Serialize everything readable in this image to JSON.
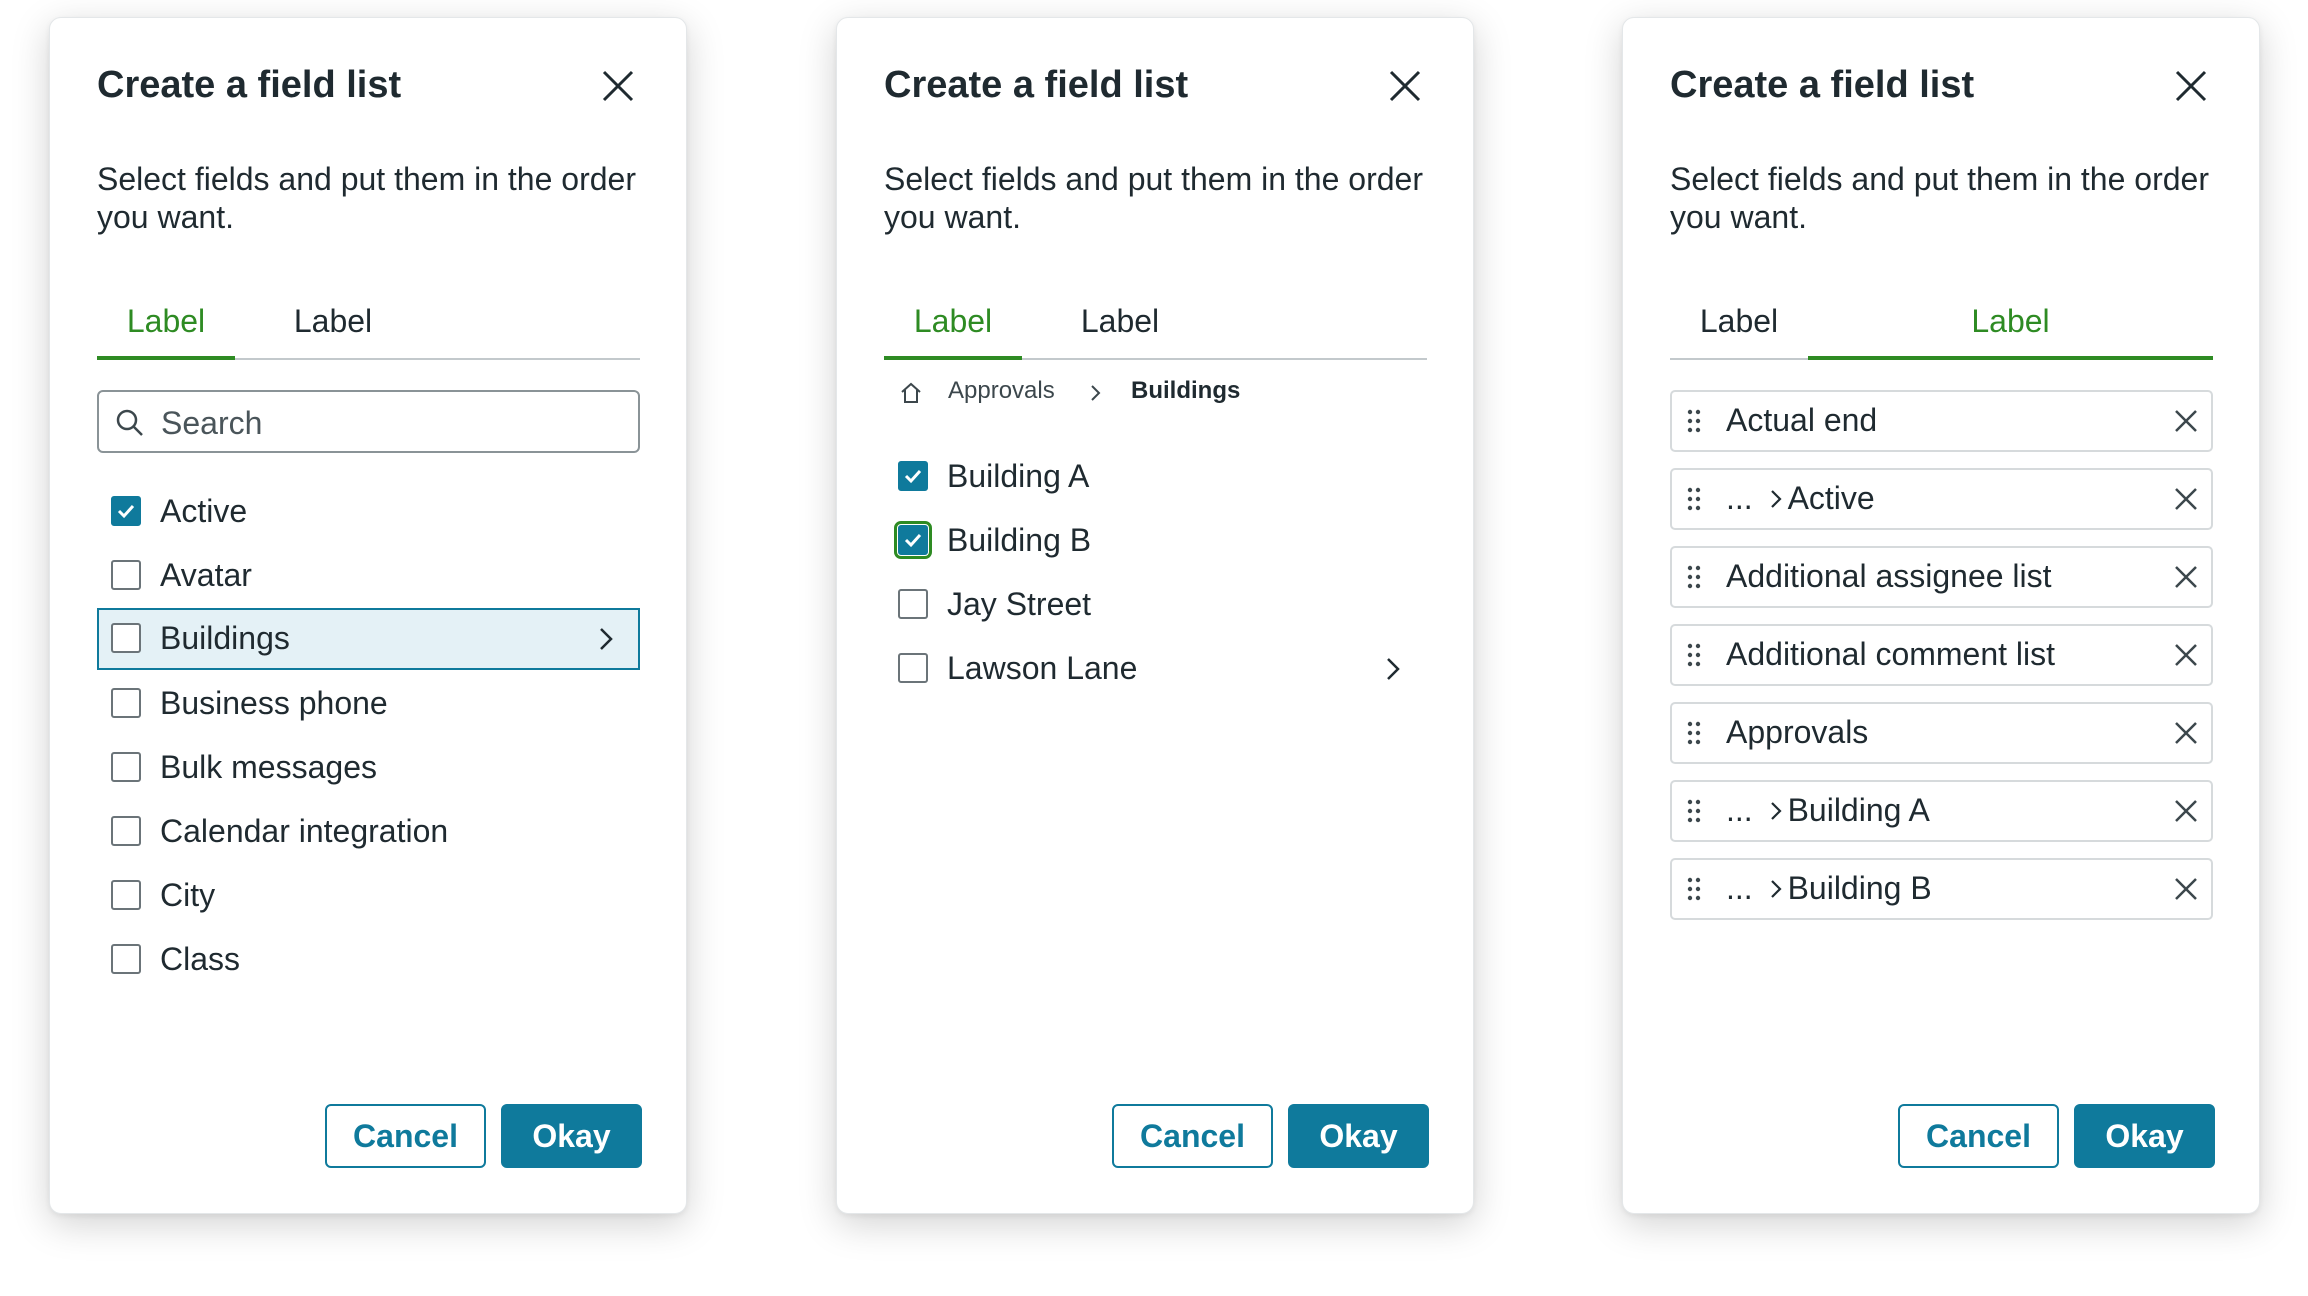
{
  "colors": {
    "accent": "#0f7a9c",
    "tab_active": "#2e8b23",
    "highlight_bg": "#e4f1f6"
  },
  "dialogs": [
    {
      "title": "Create a field list",
      "description": "Select fields and put them in the order you want.",
      "tabs": [
        {
          "label": "Label",
          "active": true
        },
        {
          "label": "Label",
          "active": false
        }
      ],
      "search": {
        "placeholder": "Search",
        "value": ""
      },
      "items": [
        {
          "label": "Active",
          "checked": true
        },
        {
          "label": "Avatar",
          "checked": false
        },
        {
          "label": "Buildings",
          "checked": false,
          "has_children": true,
          "highlighted": true
        },
        {
          "label": "Business phone",
          "checked": false
        },
        {
          "label": "Bulk messages",
          "checked": false
        },
        {
          "label": "Calendar integration",
          "checked": false
        },
        {
          "label": "City",
          "checked": false
        },
        {
          "label": "Class",
          "checked": false
        }
      ],
      "cancel_label": "Cancel",
      "ok_label": "Okay"
    },
    {
      "title": "Create a field list",
      "description": "Select fields and put them in the order you want.",
      "tabs": [
        {
          "label": "Label",
          "active": true
        },
        {
          "label": "Label",
          "active": false
        }
      ],
      "breadcrumb": {
        "home_icon": "home-icon",
        "parent": "Approvals",
        "current": "Buildings"
      },
      "items": [
        {
          "label": "Building A",
          "checked": true
        },
        {
          "label": "Building B",
          "checked": true,
          "focused": true
        },
        {
          "label": "Jay Street",
          "checked": false
        },
        {
          "label": "Lawson Lane",
          "checked": false,
          "has_children": true
        }
      ],
      "cancel_label": "Cancel",
      "ok_label": "Okay"
    },
    {
      "title": "Create a field list",
      "description": "Select fields and put them in the order you want.",
      "tabs": [
        {
          "label": "Label",
          "active": false
        },
        {
          "label": "Label",
          "active": true
        }
      ],
      "selected": [
        {
          "prefix": "",
          "label": "Actual end"
        },
        {
          "prefix": "... ",
          "label": "Active"
        },
        {
          "prefix": "",
          "label": "Additional assignee list"
        },
        {
          "prefix": "",
          "label": "Additional comment list"
        },
        {
          "prefix": "",
          "label": "Approvals"
        },
        {
          "prefix": "... ",
          "label": "Building A"
        },
        {
          "prefix": "... ",
          "label": "Building B"
        }
      ],
      "cancel_label": "Cancel",
      "ok_label": "Okay"
    }
  ]
}
